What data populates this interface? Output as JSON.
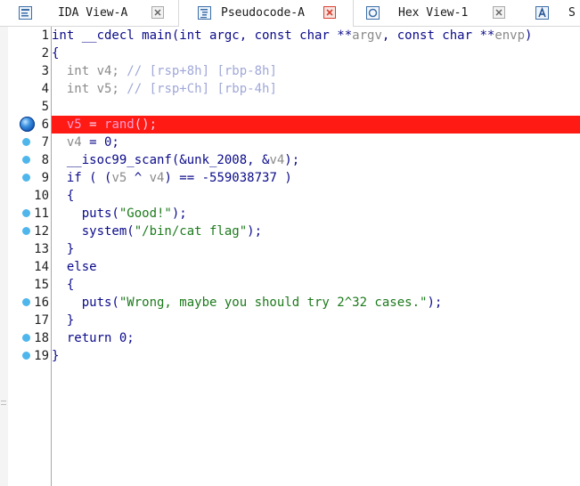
{
  "tabs": [
    {
      "label": "IDA View-A",
      "icon": "ida-view-icon",
      "active": false
    },
    {
      "label": "Pseudocode-A",
      "icon": "pseudocode-icon",
      "active": true
    },
    {
      "label": "Hex View-1",
      "icon": "hex-view-icon",
      "active": false
    },
    {
      "label": "S",
      "icon": "structures-icon",
      "active": false
    }
  ],
  "colors": {
    "highlight_line": "#ff1a14",
    "breakpoint_dot": "#4fb6ec",
    "code_text": "#0a0a8a",
    "comment_text": "#a0a8d8",
    "string_text": "#1c7a1c"
  },
  "editor": {
    "current_line": 6,
    "line_numbers": [
      "1",
      "2",
      "3",
      "4",
      "5",
      "6",
      "7",
      "8",
      "9",
      "10",
      "11",
      "12",
      "13",
      "14",
      "15",
      "16",
      "17",
      "18",
      "19"
    ],
    "breakpoint_lines": [
      6,
      7,
      8,
      9,
      11,
      12,
      16,
      18,
      19
    ],
    "lines": [
      [
        {
          "t": "int __cdecl main(int argc, const char **",
          "c": "code"
        },
        {
          "t": "argv",
          "c": "gray"
        },
        {
          "t": ", const char **",
          "c": "code"
        },
        {
          "t": "envp",
          "c": "gray"
        },
        {
          "t": ")",
          "c": "code"
        }
      ],
      [
        {
          "t": "{",
          "c": "code"
        }
      ],
      [
        {
          "t": "  int v4; ",
          "c": "gray"
        },
        {
          "t": "// [rsp+8h] [rbp-8h]",
          "c": "cmt"
        }
      ],
      [
        {
          "t": "  int v5; ",
          "c": "gray"
        },
        {
          "t": "// [rsp+Ch] [rbp-4h]",
          "c": "cmt"
        }
      ],
      [
        {
          "t": "",
          "c": "code"
        }
      ],
      [
        {
          "t": "  ",
          "c": "code"
        },
        {
          "t": "v5",
          "c": "pink"
        },
        {
          "t": " = ",
          "c": "hlt"
        },
        {
          "t": "rand",
          "c": "pink"
        },
        {
          "t": "();",
          "c": "hlt"
        }
      ],
      [
        {
          "t": "  ",
          "c": "code"
        },
        {
          "t": "v4",
          "c": "gray"
        },
        {
          "t": " = 0;",
          "c": "code"
        }
      ],
      [
        {
          "t": "  __isoc99_scanf(&unk_2008, &",
          "c": "code"
        },
        {
          "t": "v4",
          "c": "gray"
        },
        {
          "t": ");",
          "c": "code"
        }
      ],
      [
        {
          "t": "  if ( (",
          "c": "code"
        },
        {
          "t": "v5",
          "c": "gray"
        },
        {
          "t": " ^ ",
          "c": "code"
        },
        {
          "t": "v4",
          "c": "gray"
        },
        {
          "t": ") == -559038737 )",
          "c": "code"
        }
      ],
      [
        {
          "t": "  {",
          "c": "code"
        }
      ],
      [
        {
          "t": "    puts(",
          "c": "code"
        },
        {
          "t": "\"Good!\"",
          "c": "grn"
        },
        {
          "t": ");",
          "c": "code"
        }
      ],
      [
        {
          "t": "    system(",
          "c": "code"
        },
        {
          "t": "\"/bin/cat flag\"",
          "c": "grn"
        },
        {
          "t": ");",
          "c": "code"
        }
      ],
      [
        {
          "t": "  }",
          "c": "code"
        }
      ],
      [
        {
          "t": "  else",
          "c": "code"
        }
      ],
      [
        {
          "t": "  {",
          "c": "code"
        }
      ],
      [
        {
          "t": "    puts(",
          "c": "code"
        },
        {
          "t": "\"Wrong, maybe you should try 2^32 cases.\"",
          "c": "grn"
        },
        {
          "t": ");",
          "c": "code"
        }
      ],
      [
        {
          "t": "  }",
          "c": "code"
        }
      ],
      [
        {
          "t": "  return 0;",
          "c": "code"
        }
      ],
      [
        {
          "t": "}",
          "c": "code"
        }
      ]
    ]
  }
}
